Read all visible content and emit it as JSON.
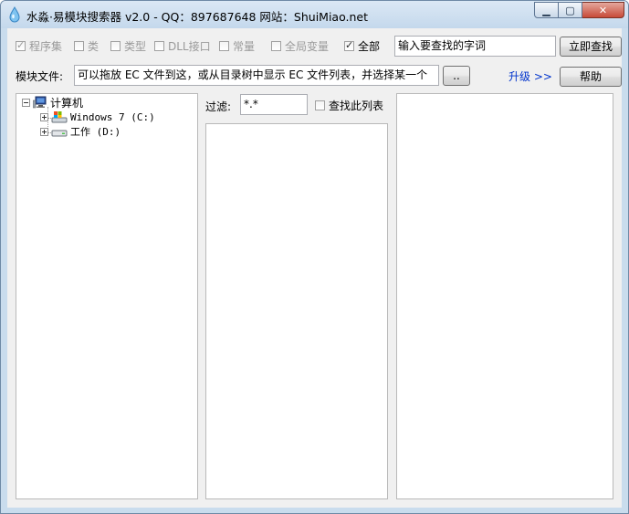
{
  "window": {
    "title": "水淼·易模块搜索器 v2.0 - QQ：897687648 网站：ShuiMiao.net",
    "minimize_label": "▁",
    "maximize_label": "▢",
    "close_label": "✕"
  },
  "filters": [
    {
      "label": "程序集",
      "checked": true,
      "disabled": true
    },
    {
      "label": "类",
      "checked": false,
      "disabled": false
    },
    {
      "label": "类型",
      "checked": false,
      "disabled": false
    },
    {
      "label": "DLL接口",
      "checked": false,
      "disabled": false
    },
    {
      "label": "常量",
      "checked": false,
      "disabled": false
    },
    {
      "label": "全局变量",
      "checked": false,
      "disabled": false
    },
    {
      "label": "全部",
      "checked": true,
      "disabled": false
    }
  ],
  "search": {
    "value": "输入要查找的字词",
    "button_label": "立即查找"
  },
  "module_file": {
    "label": "模块文件:",
    "value": "可以拖放 EC 文件到这，或从目录树中显示 EC 文件列表，并选择某一个",
    "browse_label": ".."
  },
  "upgrade_link": "升级 >>",
  "help_button": "帮助",
  "tree": {
    "root": "计算机",
    "children": [
      "Windows 7 (C:)",
      "工作 (D:)"
    ]
  },
  "filter": {
    "label": "过滤:",
    "value": "*.*",
    "search_list_label": "查找此列表",
    "search_list_checked": false
  }
}
